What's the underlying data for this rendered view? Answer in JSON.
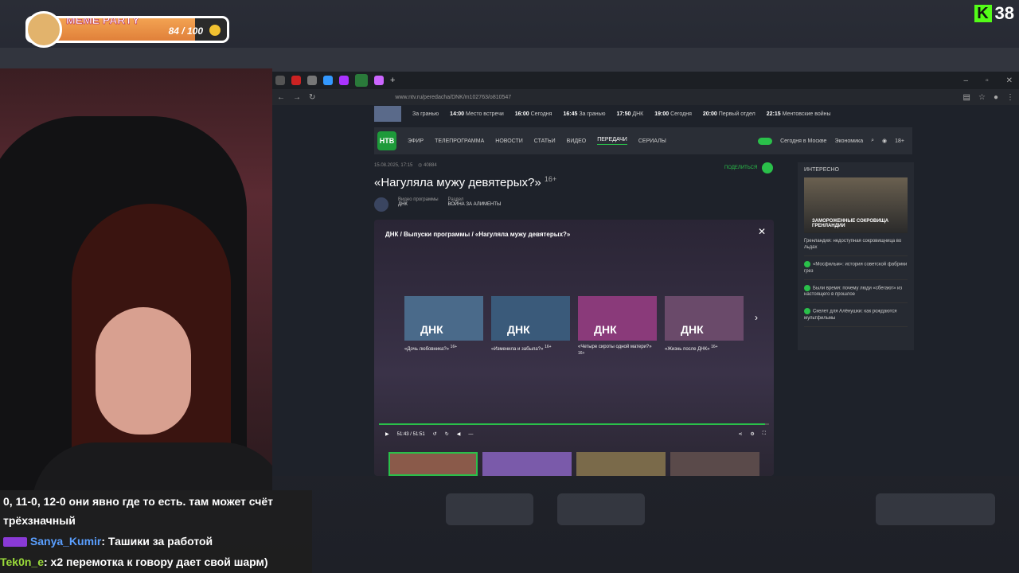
{
  "overlay": {
    "meme_title": "MEME PARTY",
    "meme_value": "84 / 100",
    "meme_progress": 0.84,
    "kick_label": "K",
    "kick_count": "38"
  },
  "browser": {
    "url": "www.ntv.ru/peredacha/DNK/m102763/o810547"
  },
  "schedule": [
    {
      "time": "",
      "title": "За гранью"
    },
    {
      "time": "14:00",
      "title": "Место встречи"
    },
    {
      "time": "16:00",
      "title": "Сегодня"
    },
    {
      "time": "16:45",
      "title": "За гранью"
    },
    {
      "time": "17:50",
      "title": "ДНК"
    },
    {
      "time": "19:00",
      "title": "Сегодня"
    },
    {
      "time": "20:00",
      "title": "Первый отдел"
    },
    {
      "time": "22:15",
      "title": "Ментовские войны"
    }
  ],
  "nav": {
    "logo": "НТВ",
    "items": [
      "ЭФИР",
      "ТЕЛЕПРОГРАММА",
      "НОВОСТИ",
      "СТАТЬИ",
      "ВИДЕО",
      "ПЕРЕДАЧИ",
      "СЕРИАЛЫ"
    ],
    "right1": "Сегодня в Москве",
    "right2": "Экономика",
    "age": "18+"
  },
  "article": {
    "date": "15.08.2025, 17:15",
    "views": "40884",
    "share": "ПОДЕЛИТЬСЯ",
    "title": "«Нагуляла мужу девятерых?»",
    "age": "16+",
    "prog_label": "Видео программы",
    "prog_value": "ДНК",
    "section_label": "Раздел",
    "section_value": "ВОЙНА ЗА АЛИМЕНТЫ"
  },
  "player": {
    "breadcrumb": "ДНК / Выпуски программы / «Нагуляла мужу девятерых?»",
    "time": "51:43 / 51:51",
    "progress": 0.99,
    "episodes": [
      {
        "title": "«Дочь любовника?»",
        "age": "16+"
      },
      {
        "title": "«Изменила и забыла?»",
        "age": "16+"
      },
      {
        "title": "«Четыре сироты одной матери?»",
        "age": "16+"
      },
      {
        "title": "«Жизнь после ДНК»",
        "age": "16+"
      }
    ],
    "brand": "ДНК"
  },
  "sidebar": {
    "header": "ИНТЕРЕСНО",
    "pic_caption": "ЗАМОРОЖЕННЫЕ СОКРОВИЩА ГРЕНЛАНДИИ",
    "items": [
      "Гренландия: недоступная сокровищница во льдах",
      "«Мосфильм»: история советской фабрики грез",
      "Были время: почему люди «сбегают» из настоящего в прошлое",
      "Скелет для Алёнушки: как рождаются мультфильмы"
    ]
  },
  "chat": [
    {
      "user": "",
      "text": "0, 11-0, 12-0 они явно где то есть. там может счёт"
    },
    {
      "user": "",
      "text": "трёхзначный"
    },
    {
      "user": "Sanya_Kumir",
      "text": ": Ташики за работой"
    },
    {
      "user": "Tek0n_e",
      "text": ": x2 перемотка к говору дает свой шарм)"
    }
  ]
}
